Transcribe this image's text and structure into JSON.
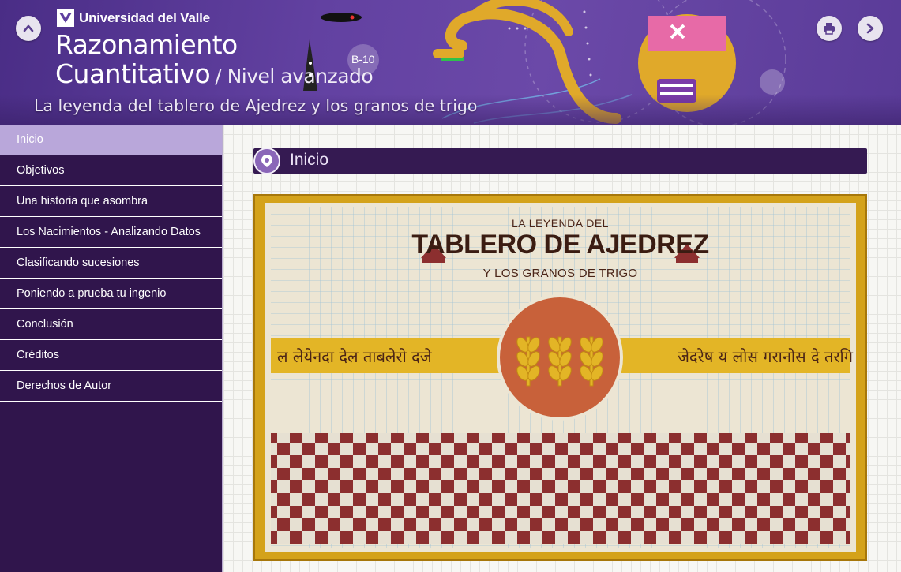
{
  "header": {
    "university": "Universidad del Valle",
    "title_line1": "Razonamiento",
    "title_line2": "Cuantitativo",
    "level": "/ Nivel avanzado",
    "subtitle": "La leyenda del tablero de Ajedrez y los granos de trigo",
    "badge": "B-10",
    "icons": [
      "chevron-up-icon",
      "print-icon",
      "chevron-right-icon"
    ]
  },
  "sidebar": {
    "items": [
      {
        "label": "Inicio",
        "active": true
      },
      {
        "label": "Objetivos"
      },
      {
        "label": "Una historia que asombra"
      },
      {
        "label": "Los Nacimientos - Analizando Datos"
      },
      {
        "label": "Clasificando sucesiones"
      },
      {
        "label": "Poniendo a prueba tu ingenio"
      },
      {
        "label": "Conclusión"
      },
      {
        "label": "Créditos"
      },
      {
        "label": "Derechos de Autor"
      }
    ]
  },
  "main": {
    "section_title": "Inicio",
    "hero": {
      "line1": "LA LEYENDA DEL",
      "line2": "TABLERO DE AJEDREZ",
      "line3": "Y LOS GRANOS DE TRIGO",
      "band_left": "ल लेयेनदा देल ताबलेरो दजे",
      "band_right": "जेदरेष य लोस गरानोस दे तरगि"
    }
  },
  "colors": {
    "header_purple": "#5f3f9f",
    "sidebar_bg": "#30154c",
    "sidebar_active": "#b9a7da",
    "section_bar": "#351a52",
    "frame_gold": "#d4a21a",
    "checker_red": "#8c2f2f",
    "band_yellow": "#e3b526",
    "sun_orange": "#c8613a"
  }
}
